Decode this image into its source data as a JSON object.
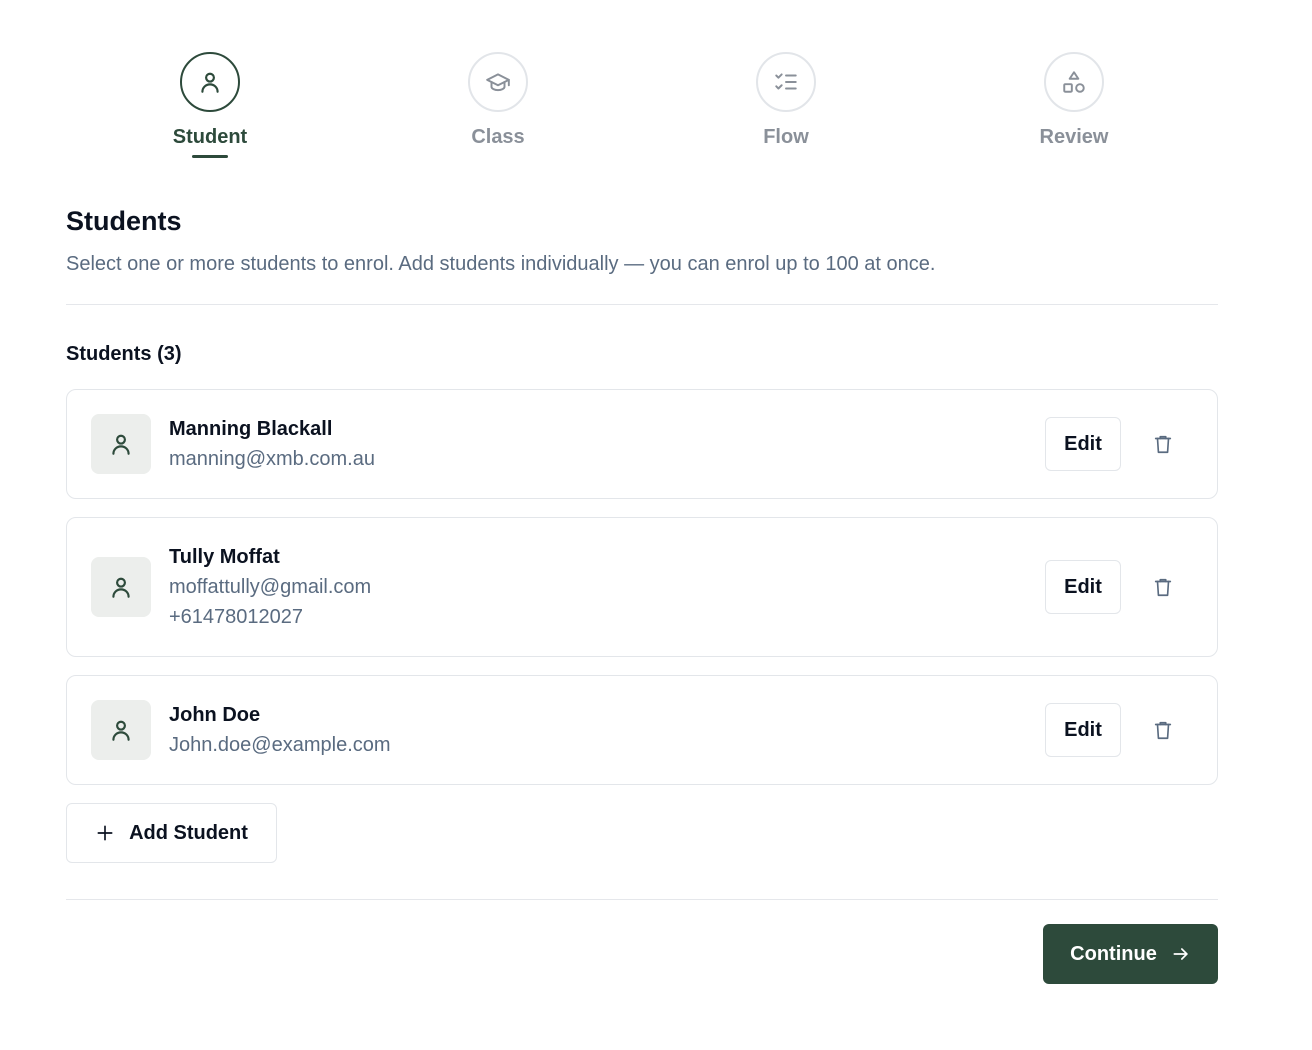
{
  "stepper": {
    "steps": [
      {
        "label": "Student",
        "icon": "user-icon",
        "state": "active"
      },
      {
        "label": "Class",
        "icon": "graduation-cap-icon",
        "state": "inactive"
      },
      {
        "label": "Flow",
        "icon": "checklist-icon",
        "state": "inactive"
      },
      {
        "label": "Review",
        "icon": "shapes-icon",
        "state": "inactive"
      }
    ]
  },
  "header": {
    "title": "Students",
    "description": "Select one or more students to enrol. Add students individually — you can enrol up to 100 at once."
  },
  "students": {
    "section_title": "Students (3)",
    "edit_label": "Edit",
    "items": [
      {
        "name": "Manning Blackall",
        "email": "manning@xmb.com.au",
        "phone": ""
      },
      {
        "name": "Tully Moffat",
        "email": "moffattully@gmail.com",
        "phone": "+61478012027"
      },
      {
        "name": "John Doe",
        "email": "John.doe@example.com",
        "phone": ""
      }
    ]
  },
  "actions": {
    "add_student_label": "Add Student",
    "continue_label": "Continue"
  },
  "colors": {
    "accent": "#2d4a3b",
    "muted_text": "#5a6b80",
    "border": "#e3e6ea",
    "inactive_step": "#8a9099"
  }
}
